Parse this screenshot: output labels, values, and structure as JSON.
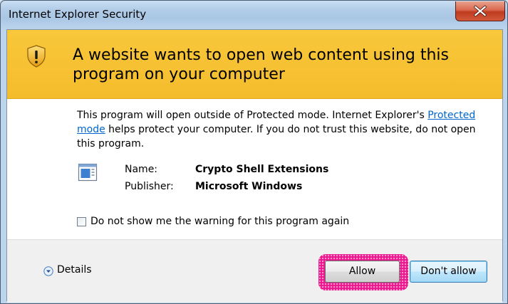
{
  "window": {
    "title": "Internet Explorer Security",
    "close_icon": "close-icon"
  },
  "banner": {
    "icon": "shield-warning-icon",
    "title": "A website wants to open web content using this program on your computer",
    "background": "#f6c22f"
  },
  "body": {
    "desc_part1": "This program will open outside of Protected mode. Internet Explorer's ",
    "desc_link": "Protected mode",
    "desc_part2": " helps protect your computer. If you do not trust this website, do not open this program.",
    "program_icon": "program-window-icon",
    "name_label": "Name:",
    "name_value": "Crypto Shell Extensions",
    "publisher_label": "Publisher:",
    "publisher_value": "Microsoft Windows",
    "checkbox_label": "Do not show me the warning for this program again",
    "checkbox_checked": false
  },
  "footer": {
    "details_icon": "chevron-down-circle-icon",
    "details_label": "Details",
    "allow_label": "Allow",
    "dont_allow_label": "Don't allow",
    "highlight_color": "#e9168e"
  }
}
